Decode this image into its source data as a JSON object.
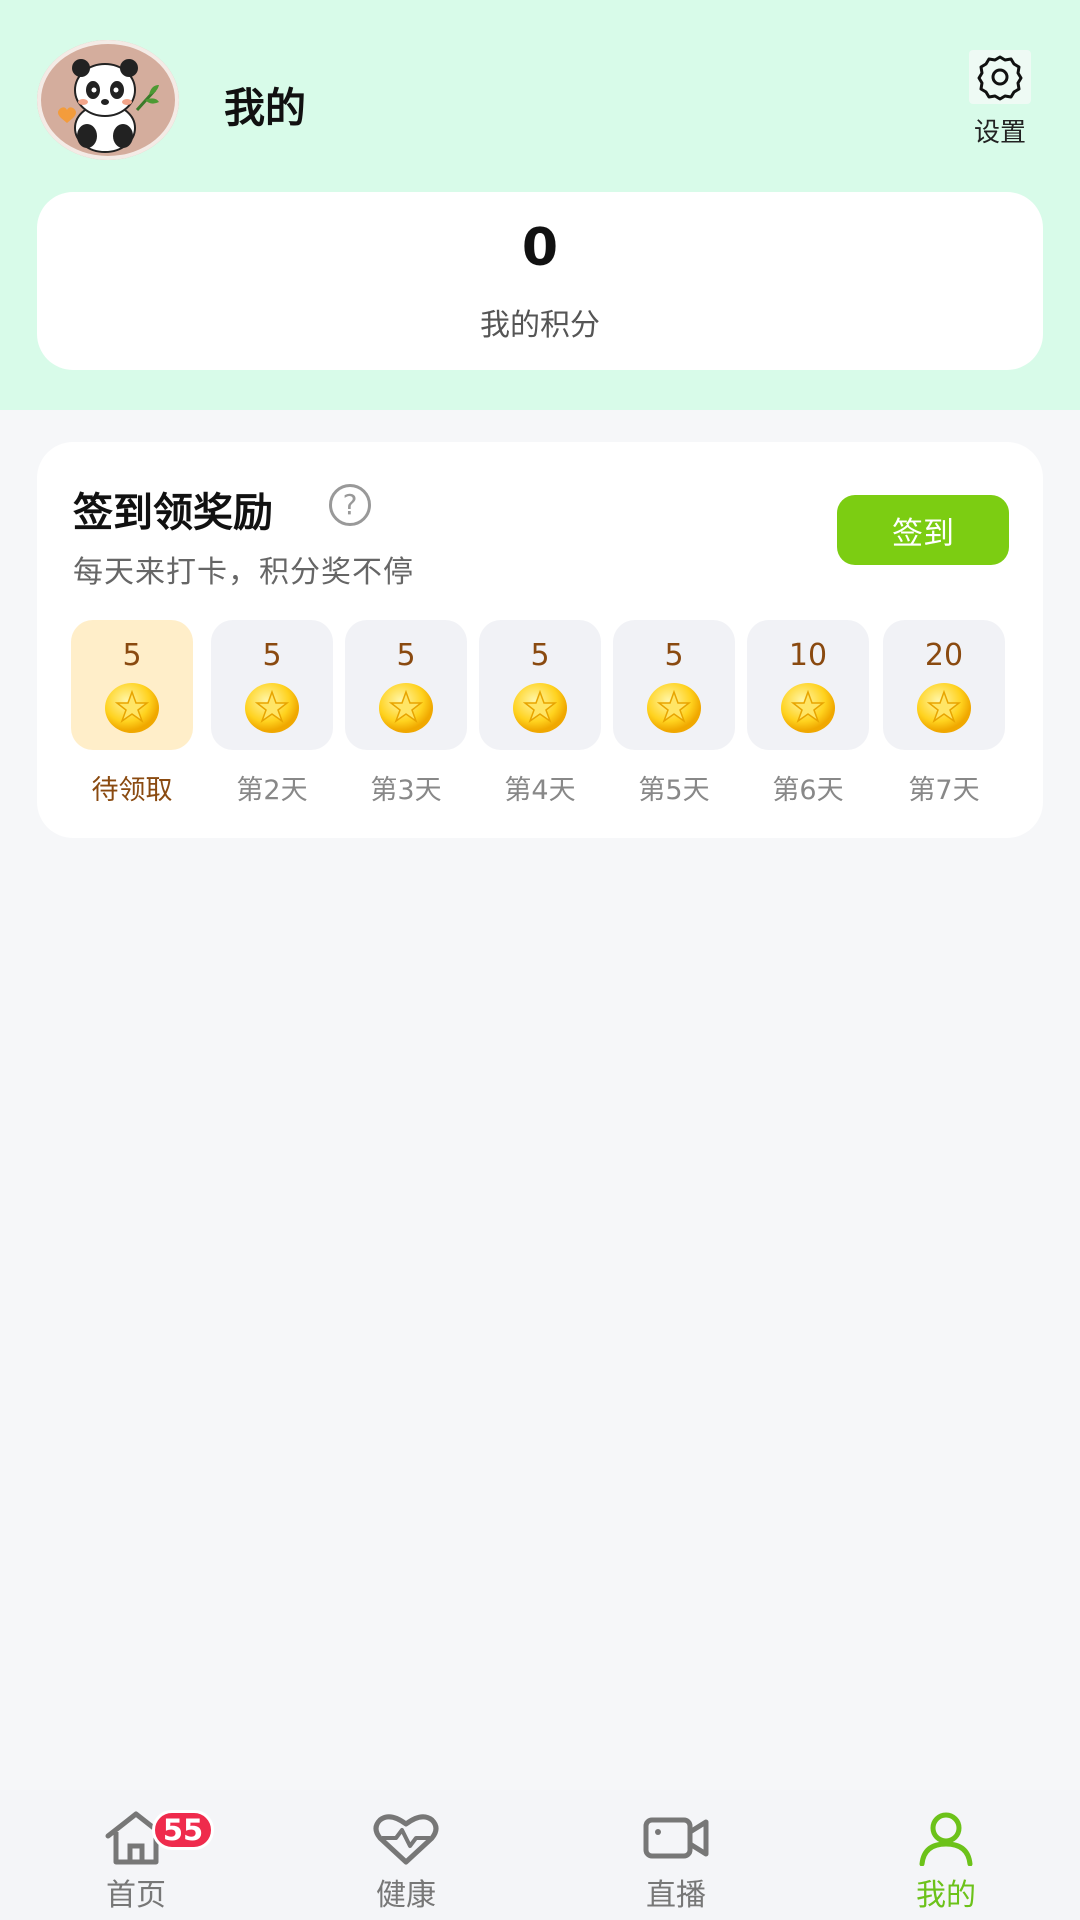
{
  "header": {
    "title": "我的",
    "settings_label": "设置",
    "avatar_icon": "panda-avatar",
    "settings_icon": "gear-icon"
  },
  "points": {
    "value": "0",
    "label": "我的积分"
  },
  "checkin": {
    "title": "签到领奖励",
    "subtitle": "每天来打卡，积分奖不停",
    "button_label": "签到",
    "help_icon": "question-icon",
    "days": [
      {
        "points": "5",
        "label": "待领取",
        "active": true
      },
      {
        "points": "5",
        "label": "第2天",
        "active": false
      },
      {
        "points": "5",
        "label": "第3天",
        "active": false
      },
      {
        "points": "5",
        "label": "第4天",
        "active": false
      },
      {
        "points": "5",
        "label": "第5天",
        "active": false
      },
      {
        "points": "10",
        "label": "第6天",
        "active": false
      },
      {
        "points": "20",
        "label": "第7天",
        "active": false
      }
    ]
  },
  "bottom_nav": {
    "items": [
      {
        "label": "首页",
        "icon": "home-icon",
        "badge": "55",
        "active": false
      },
      {
        "label": "健康",
        "icon": "heart-pulse-icon",
        "active": false
      },
      {
        "label": "直播",
        "icon": "video-camera-icon",
        "active": false
      },
      {
        "label": "我的",
        "icon": "user-icon",
        "active": true
      }
    ]
  },
  "colors": {
    "header_bg": "#d8fbe9",
    "accent_green": "#7ccd12",
    "nav_active": "#6cc21a",
    "badge_red": "#ef2b4c",
    "active_day_bg": "#ffeec9",
    "points_brown": "#8a4a10"
  }
}
